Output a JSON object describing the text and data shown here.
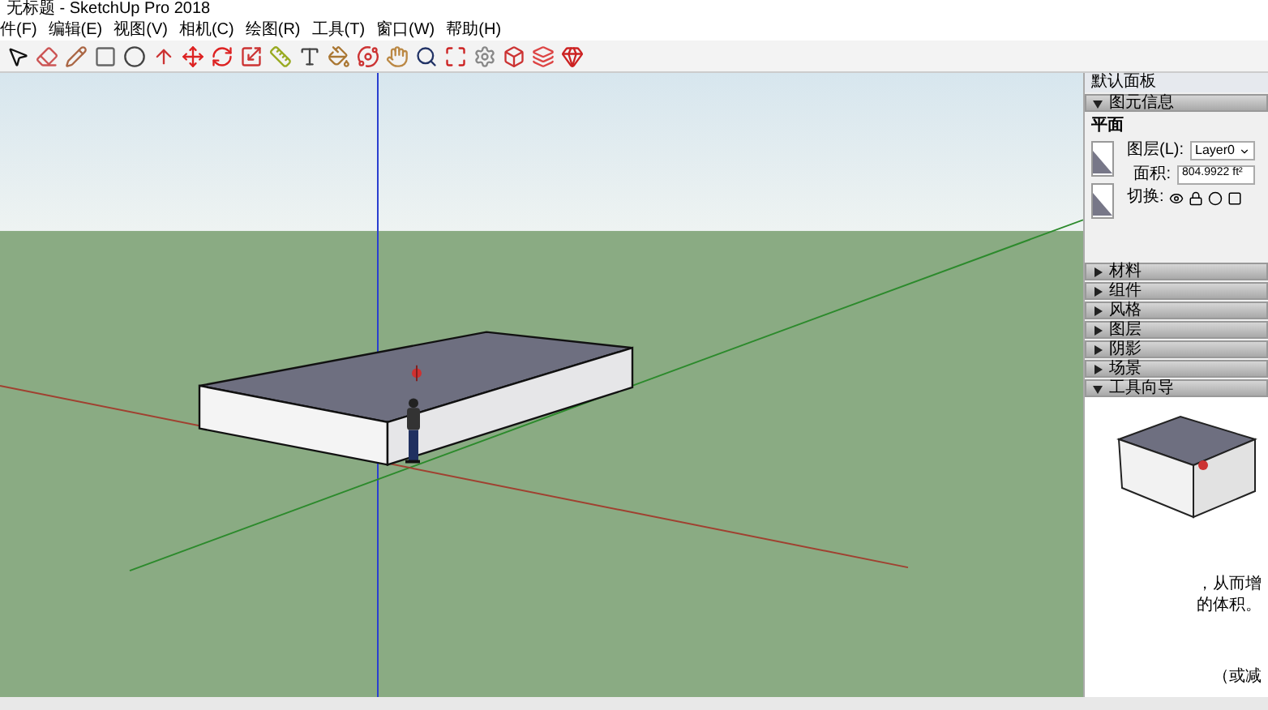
{
  "window": {
    "title": "无标题 - SketchUp Pro 2018"
  },
  "menu": [
    "件(F)",
    "编辑(E)",
    "视图(V)",
    "相机(C)",
    "绘图(R)",
    "工具(T)",
    "窗口(W)",
    "帮助(H)"
  ],
  "panel": {
    "title": "默认面板",
    "sections": [
      {
        "title": "图元信息",
        "expanded": true,
        "kind": "entity_info"
      },
      {
        "title": "材料",
        "expanded": false
      },
      {
        "title": "组件",
        "expanded": false
      },
      {
        "title": "风格",
        "expanded": false
      },
      {
        "title": "图层",
        "expanded": false
      },
      {
        "title": "阴影",
        "expanded": false
      },
      {
        "title": "场景",
        "expanded": false
      },
      {
        "title": "工具向导",
        "expanded": true,
        "kind": "tool_guide"
      }
    ]
  },
  "entity_info": {
    "type": "平面",
    "layer_label": "图层(L):",
    "layer": "Layer0",
    "area_label": "面积:",
    "area": "804.9922 ft²",
    "toggle_label": "切换:"
  },
  "tool_guide": {
    "fragments": [
      "，从而增",
      "的体积。",
      "（或减"
    ]
  }
}
